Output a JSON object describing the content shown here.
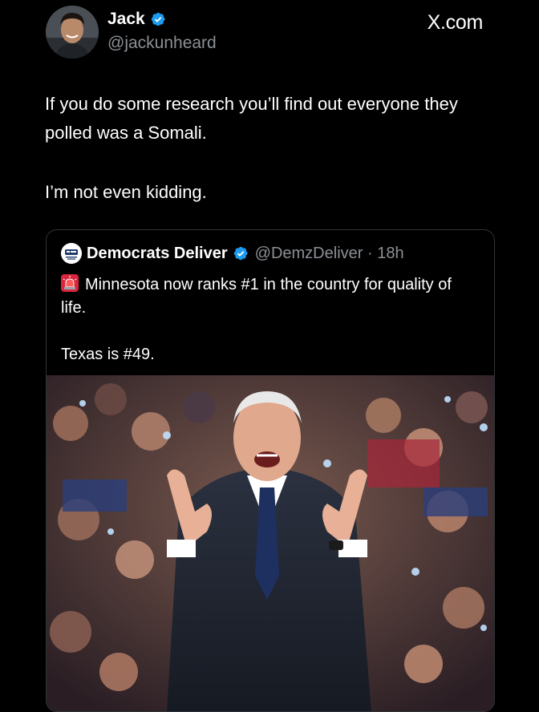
{
  "author": {
    "name": "Jack",
    "handle": "@jackunheard",
    "avatar_icon": "profile-photo"
  },
  "site_label": "X.com",
  "tweet": {
    "paragraphs": [
      "If you do some research you’ll find out everyone they polled was a Somali.",
      "I’m not even kidding."
    ]
  },
  "quoted_tweet": {
    "name": "Democrats Deliver",
    "handle_time": "@DemzDeliver · 18h",
    "logo_icon": "democrats-deliver-logo",
    "siren_icon": "police-siren-emoji",
    "line1": "Minnesota now ranks #1 in the country for quality of life.",
    "line2": "Texas is #49.",
    "photo": "man-in-suit-clapping-and-laughing-before-crowd"
  },
  "colors": {
    "background": "#000000",
    "text": "#ffffff",
    "muted": "#8b9096",
    "verified": "#1d9bf0",
    "border": "#2f3336"
  }
}
